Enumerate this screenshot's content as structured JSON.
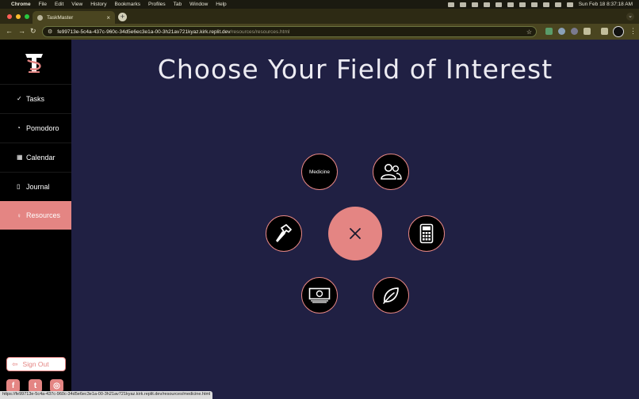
{
  "menubar": {
    "app": "Chrome",
    "items": [
      "File",
      "Edit",
      "View",
      "History",
      "Bookmarks",
      "Profiles",
      "Tab",
      "Window",
      "Help"
    ],
    "clock": "Sun Feb 18  8:37:18 AM"
  },
  "browser": {
    "tab_title": "TaskMaster",
    "url_host": "fe99713e-5c4a-437c-960c-34d5e6ec3e1a-00-3h21av721kyaz.kirk.replit.dev",
    "url_path": "/resources/resources.html",
    "status_url": "https://fe99713e-5c4a-437c-960c-34d5e6ec3e1a-00-3h21av721kyaz.kirk.replit.dev/resources/medicine.html"
  },
  "sidebar": {
    "items": [
      {
        "label": "Tasks",
        "icon": "checkmark-icon"
      },
      {
        "label": "Pomodoro",
        "icon": "timer-icon"
      },
      {
        "label": "Calendar",
        "icon": "calendar-icon"
      },
      {
        "label": "Journal",
        "icon": "book-icon"
      },
      {
        "label": "Resources",
        "icon": "lightbulb-icon",
        "active": true
      }
    ],
    "signout_label": "Sign Out",
    "social": [
      "facebook-icon",
      "twitter-icon",
      "instagram-icon"
    ]
  },
  "main": {
    "title": "Choose Your Field of Interest",
    "fields": [
      {
        "label": "Medicine",
        "icon": null
      },
      {
        "label": "",
        "icon": "people-icon"
      },
      {
        "label": "",
        "icon": "calculator-icon"
      },
      {
        "label": "",
        "icon": "leaf-icon"
      },
      {
        "label": "",
        "icon": "money-icon"
      },
      {
        "label": "",
        "icon": "hammer-icon"
      }
    ],
    "center_icon": "close-icon"
  },
  "colors": {
    "accent": "#e48583",
    "background": "#202043",
    "sidebar": "#000000"
  }
}
